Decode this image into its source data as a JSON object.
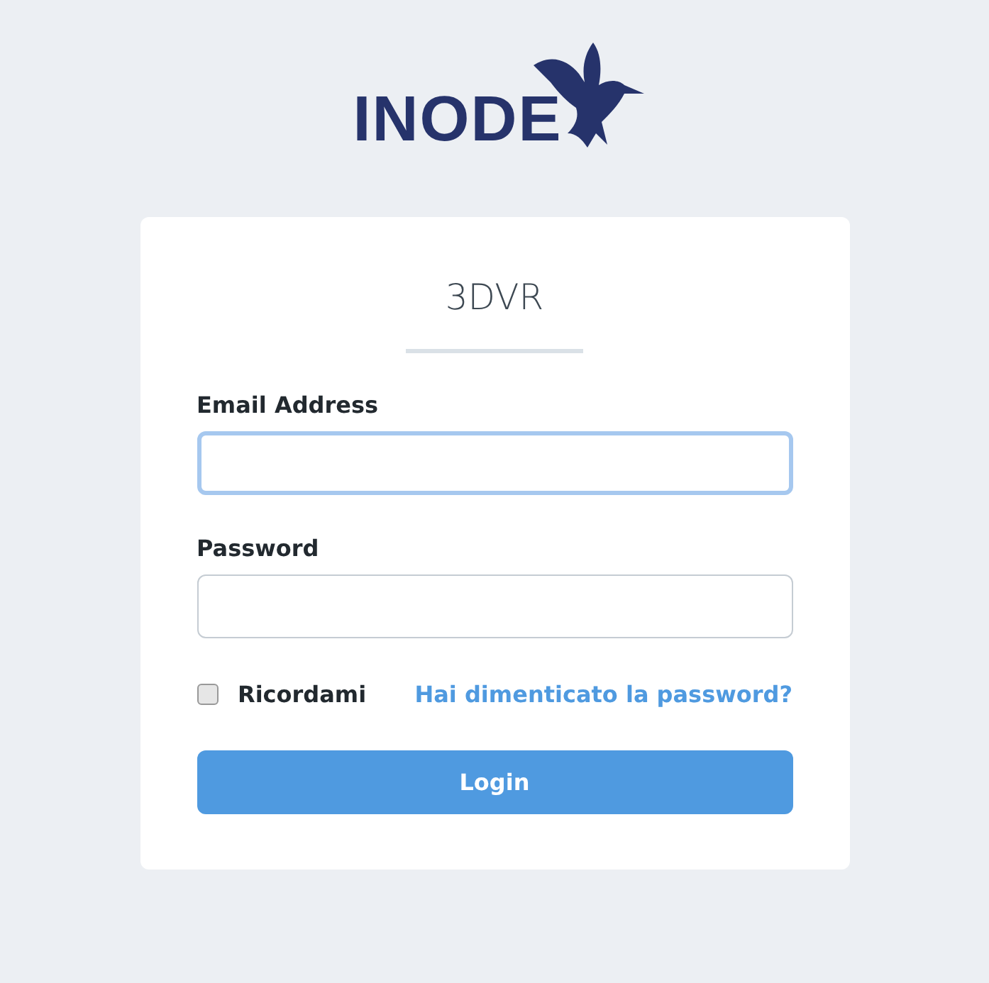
{
  "logo": {
    "text": "INODE"
  },
  "card": {
    "title": "3DVR",
    "fields": [
      {
        "label": "Email Address",
        "focused": true
      },
      {
        "label": "Password",
        "focused": false
      }
    ],
    "remember": {
      "label": "Ricordami",
      "checked": false
    },
    "forgot_link": "Hai dimenticato la password?",
    "submit": "Login"
  }
}
